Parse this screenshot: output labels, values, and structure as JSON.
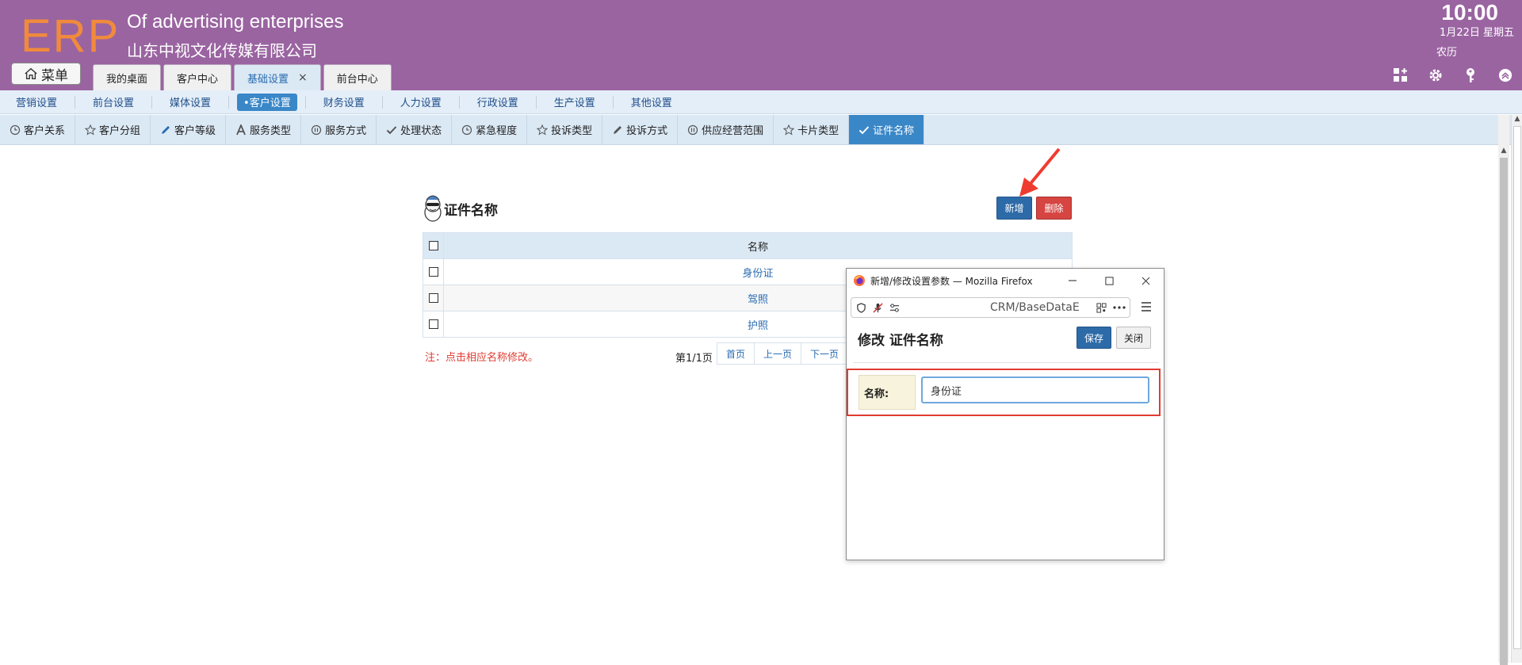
{
  "header": {
    "logo": "ERP",
    "company_en": "Of advertising enterprises",
    "company_cn": "山东中视文化传媒有限公司",
    "time": "10:00",
    "date": "1月22日 星期五",
    "lunar": "农历",
    "menu_label": "菜单",
    "tabs": [
      {
        "label": "我的桌面"
      },
      {
        "label": "客户中心"
      },
      {
        "label": "基础设置",
        "close": "×"
      },
      {
        "label": "前台中心"
      }
    ]
  },
  "subnav": {
    "items": [
      {
        "label": "营销设置"
      },
      {
        "label": "前台设置"
      },
      {
        "label": "媒体设置"
      },
      {
        "label": "•客户设置"
      },
      {
        "label": "财务设置"
      },
      {
        "label": "人力设置"
      },
      {
        "label": "行政设置"
      },
      {
        "label": "生产设置"
      },
      {
        "label": "其他设置"
      }
    ]
  },
  "thirdnav": {
    "items": [
      {
        "label": "客户关系",
        "icon": "clock-icon"
      },
      {
        "label": "客户分组",
        "icon": "star-icon"
      },
      {
        "label": "客户等级",
        "icon": "pencil-icon"
      },
      {
        "label": "服务类型",
        "icon": "letter-a-icon"
      },
      {
        "label": "服务方式",
        "icon": "pause-icon"
      },
      {
        "label": "处理状态",
        "icon": "check-icon"
      },
      {
        "label": "紧急程度",
        "icon": "clock-icon"
      },
      {
        "label": "投诉类型",
        "icon": "star-icon"
      },
      {
        "label": "投诉方式",
        "icon": "pencil-icon"
      },
      {
        "label": "供应经营范围",
        "icon": "pause-icon"
      },
      {
        "label": "卡片类型",
        "icon": "star-icon"
      },
      {
        "label": "证件名称",
        "icon": "check-icon"
      }
    ]
  },
  "main": {
    "title": "证件名称",
    "add_label": "新增",
    "delete_label": "删除",
    "table": {
      "header": "名称",
      "rows": [
        "身份证",
        "驾照",
        "护照"
      ]
    },
    "note": "注：点击相应名称修改。",
    "pager_text": "第1/1页",
    "pager": [
      "首页",
      "上一页",
      "下一页"
    ]
  },
  "popup": {
    "window_title": "新增/修改设置参数 — Mozilla Firefox",
    "url": "CRM/BaseDataE",
    "heading": "修改 证件名称",
    "save_label": "保存",
    "close_label": "关闭",
    "field_label": "名称:",
    "field_value": "身份证"
  },
  "colors": {
    "header_bg": "#9a64a1",
    "logo": "#f08a3c",
    "primary_button": "#2d6aa8",
    "danger_button": "#d64541",
    "highlight_box": "#e03b30"
  }
}
